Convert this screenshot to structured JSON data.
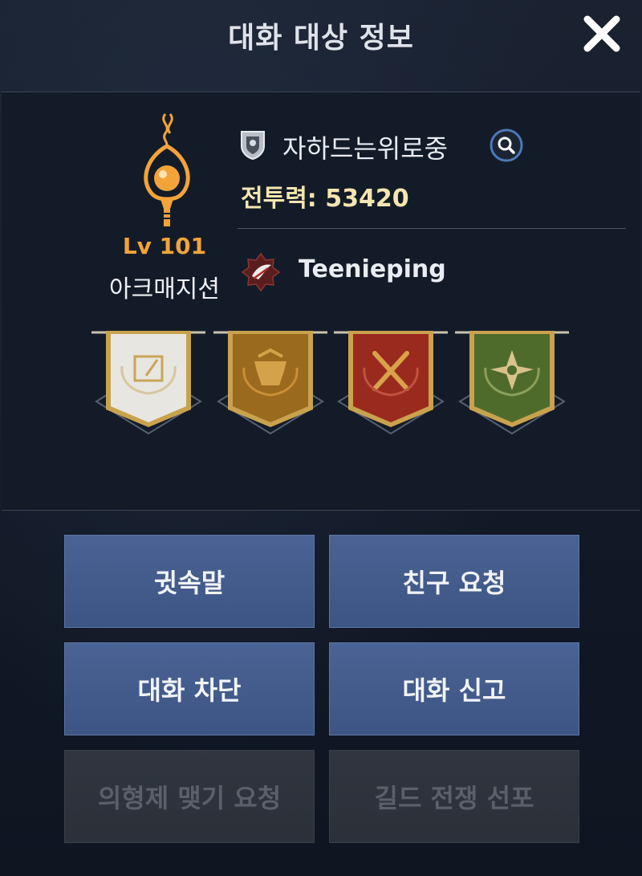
{
  "header": {
    "title": "대화 대상 정보",
    "close_icon": "close-icon"
  },
  "profile": {
    "level": "Lv 101",
    "class_name": "아크매지션",
    "player_name": "자하드는위로중",
    "combat_power": "전투력: 53420",
    "guild_name": "Teenieping",
    "accent_color": "#f2a33a",
    "banners": [
      {
        "icon": "book-feather-icon",
        "color": "#e8e6e0"
      },
      {
        "icon": "helmet-icon",
        "color": "#9a6a1e"
      },
      {
        "icon": "crossed-swords-icon",
        "color": "#9a2a1e"
      },
      {
        "icon": "flower-icon",
        "color": "#4e6b2c"
      }
    ]
  },
  "actions": {
    "whisper": "귓속말",
    "friend_request": "친구 요청",
    "block_chat": "대화 차단",
    "report_chat": "대화 신고",
    "sworn_brother_request": "의형제 맺기 요청",
    "guild_war": "길드 전쟁 선포"
  }
}
